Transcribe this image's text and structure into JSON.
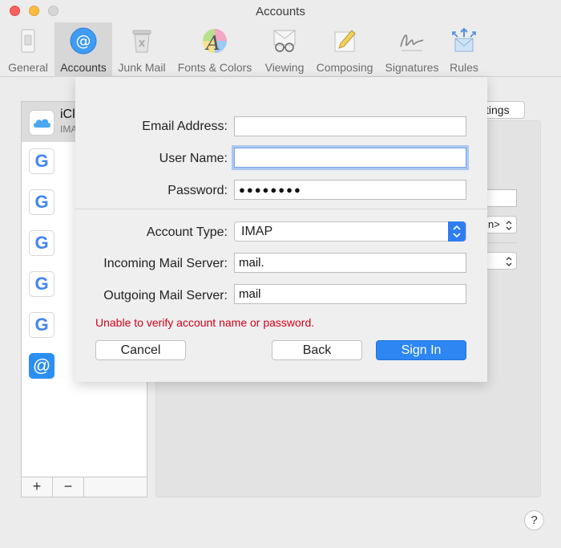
{
  "window": {
    "title": "Accounts"
  },
  "toolbar": {
    "items": [
      {
        "label": "General"
      },
      {
        "label": "Accounts"
      },
      {
        "label": "Junk Mail"
      },
      {
        "label": "Fonts & Colors"
      },
      {
        "label": "Viewing"
      },
      {
        "label": "Composing"
      },
      {
        "label": "Signatures"
      },
      {
        "label": "Rules"
      }
    ],
    "selected": "Accounts"
  },
  "accounts_list": {
    "icloud": {
      "name": "iCl",
      "sub": "IMA"
    },
    "google_letter": "G",
    "at_symbol": "@",
    "add_label": "+",
    "remove_label": "−"
  },
  "background": {
    "settings_button_label": "tings",
    "popup1_value": "n>"
  },
  "sheet": {
    "email_label": "Email Address:",
    "email_value": "",
    "username_label": "User Name:",
    "username_value": "",
    "password_label": "Password:",
    "password_value": "●●●●●●●●",
    "account_type_label": "Account Type:",
    "account_type_value": "IMAP",
    "incoming_label": "Incoming Mail Server:",
    "incoming_value": "mail.",
    "outgoing_label": "Outgoing Mail Server:",
    "outgoing_value": "mail",
    "error": "Unable to verify account name or password.",
    "cancel_label": "Cancel",
    "back_label": "Back",
    "signin_label": "Sign In"
  },
  "help_label": "?",
  "colors": {
    "accent": "#2d86f2",
    "error": "#d0021b"
  }
}
